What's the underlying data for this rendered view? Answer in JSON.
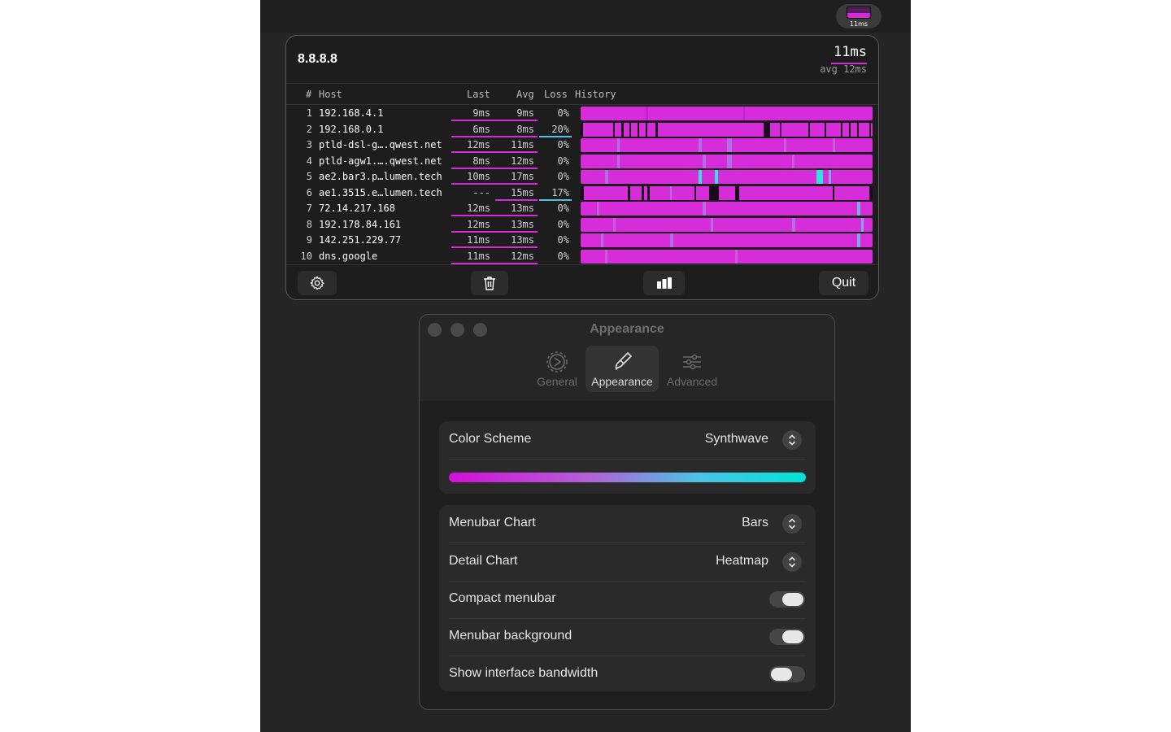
{
  "menubar": {
    "status_latency": "11ms"
  },
  "popover": {
    "host": "8.8.8.8",
    "current_latency": "11ms",
    "avg_latency": "avg 12ms",
    "columns": {
      "num": "#",
      "host": "Host",
      "last": "Last",
      "avg": "Avg",
      "loss": "Loss",
      "history": "History"
    },
    "hops": [
      {
        "num": "1",
        "host": "192.168.4.1",
        "last": "9ms",
        "avg": "9ms",
        "loss": "0%"
      },
      {
        "num": "2",
        "host": "192.168.0.1",
        "last": "6ms",
        "avg": "8ms",
        "loss": "20%"
      },
      {
        "num": "3",
        "host": "ptld-dsl-g….qwest.net",
        "last": "12ms",
        "avg": "11ms",
        "loss": "0%"
      },
      {
        "num": "4",
        "host": "ptld-agw1.….qwest.net",
        "last": "8ms",
        "avg": "12ms",
        "loss": "0%"
      },
      {
        "num": "5",
        "host": "ae2.bar3.p…lumen.tech",
        "last": "10ms",
        "avg": "17ms",
        "loss": "0%"
      },
      {
        "num": "6",
        "host": "ae1.3515.e…lumen.tech",
        "last": "---",
        "avg": "15ms",
        "loss": "17%"
      },
      {
        "num": "7",
        "host": "72.14.217.168",
        "last": "12ms",
        "avg": "13ms",
        "loss": "0%"
      },
      {
        "num": "8",
        "host": "192.178.84.161",
        "last": "12ms",
        "avg": "13ms",
        "loss": "0%"
      },
      {
        "num": "9",
        "host": "142.251.229.77",
        "last": "11ms",
        "avg": "13ms",
        "loss": "0%"
      },
      {
        "num": "10",
        "host": "dns.google",
        "last": "11ms",
        "avg": "12ms",
        "loss": "0%"
      }
    ],
    "footer": {
      "quit_label": "Quit"
    }
  },
  "settings": {
    "window_title": "Appearance",
    "tabs": [
      {
        "label": "General",
        "icon": "gear-icon",
        "selected": false
      },
      {
        "label": "Appearance",
        "icon": "paintbrush-icon",
        "selected": true
      },
      {
        "label": "Advanced",
        "icon": "sliders-icon",
        "selected": false
      }
    ],
    "color_scheme": {
      "label": "Color Scheme",
      "value": "Synthwave",
      "gradient": [
        "#d20fd8",
        "#b262d6",
        "#4ac3e6",
        "#00e2d6"
      ]
    },
    "menubar_chart": {
      "label": "Menubar Chart",
      "value": "Bars"
    },
    "detail_chart": {
      "label": "Detail Chart",
      "value": "Heatmap"
    },
    "compact_menubar": {
      "label": "Compact menubar",
      "on": true
    },
    "menubar_background": {
      "label": "Menubar background",
      "on": true
    },
    "show_interface_bandwidth": {
      "label": "Show interface bandwidth",
      "on": false
    }
  },
  "colors": {
    "accent": "#d22bd9",
    "loss_accent": "#4ac3e6",
    "background": "#252525"
  }
}
